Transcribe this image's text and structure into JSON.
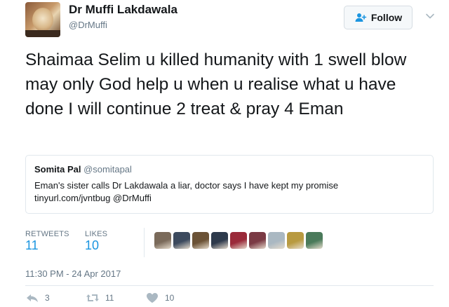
{
  "author": {
    "name": "Dr Muffi Lakdawala",
    "handle": "@DrMuffi"
  },
  "follow_button": {
    "label": "Follow",
    "icon": "add-user-icon"
  },
  "tweet": {
    "text": "Shaimaa Selim u killed humanity with 1 swell blow may only God help u when u realise what u have done I will continue 2 treat & pray 4 Eman"
  },
  "quoted_tweet": {
    "author_name": "Somita Pal",
    "author_handle": "@somitapal",
    "text_line1": "Eman's sister calls Dr Lakdawala a liar, doctor says I have kept my promise",
    "text_line2": "tinyurl.com/jvntbug @DrMuffi"
  },
  "stats": {
    "retweets_label": "RETWEETS",
    "retweets_count": "11",
    "likes_label": "LIKES",
    "likes_count": "10"
  },
  "likers": [
    {
      "name": "liker-avatar-1",
      "color": "#7a6a5a"
    },
    {
      "name": "liker-avatar-2",
      "color": "#3c4a5e"
    },
    {
      "name": "liker-avatar-3",
      "color": "#6b5236"
    },
    {
      "name": "liker-avatar-4",
      "color": "#2e3a4c"
    },
    {
      "name": "liker-avatar-5",
      "color": "#9a2a3a"
    },
    {
      "name": "liker-avatar-6",
      "color": "#7a3a44"
    },
    {
      "name": "liker-avatar-7",
      "color": "#aab8c2"
    },
    {
      "name": "liker-avatar-8",
      "color": "#b89a40"
    },
    {
      "name": "liker-avatar-9",
      "color": "#4a7a5a"
    }
  ],
  "timestamp": "11:30 PM - 24 Apr 2017",
  "actions": {
    "reply_count": "3",
    "retweet_count": "11",
    "like_count": "10"
  },
  "colors": {
    "link": "#1b95e0",
    "muted": "#657786",
    "text": "#14171a",
    "border": "#e1e8ed"
  }
}
